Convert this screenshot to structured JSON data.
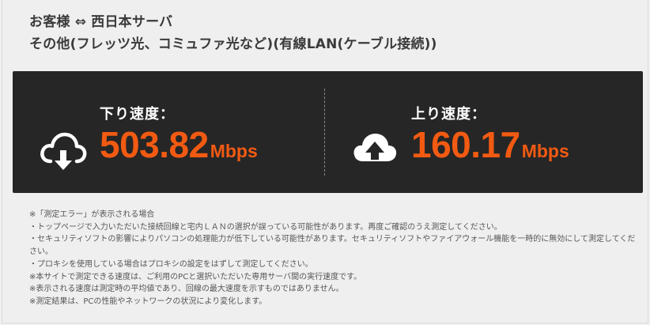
{
  "header": {
    "line1": "お客様 ⇔ 西日本サーバ",
    "line2": "その他(フレッツ光、コミュファ光など)(有線LAN(ケーブル接続))"
  },
  "results": {
    "download": {
      "label": "下り速度：",
      "value": "503.82",
      "unit": "Mbps",
      "icon": "cloud-download-icon"
    },
    "upload": {
      "label": "上り速度：",
      "value": "160.17",
      "unit": "Mbps",
      "icon": "cloud-upload-icon"
    }
  },
  "colors": {
    "accent": "#f25a12",
    "panel": "#262626",
    "background": "#efefef"
  },
  "notes": [
    "※「測定エラー」が表示される場合",
    "・トップページで入力いただいた接続回線と宅内ＬＡＮの選択が誤っている可能性があります。再度ご確認のうえ測定してください。",
    "・セキュリティソフトの影響によりパソコンの処理能力が低下している可能性があります。セキュリティソフトやファイアウォール機能を一時的に無効にして測定してください。",
    "・プロキシを使用している場合はプロキシの設定をはずして測定してください。",
    "※本サイトで測定できる速度は、ご利用のPCと選択いただいた専用サーバ間の実行速度です。",
    "※表示される速度は測定時の平均値であり、回線の最大速度を示すものではありません。",
    "※測定結果は、PCの性能やネットワークの状況により変化します。"
  ]
}
